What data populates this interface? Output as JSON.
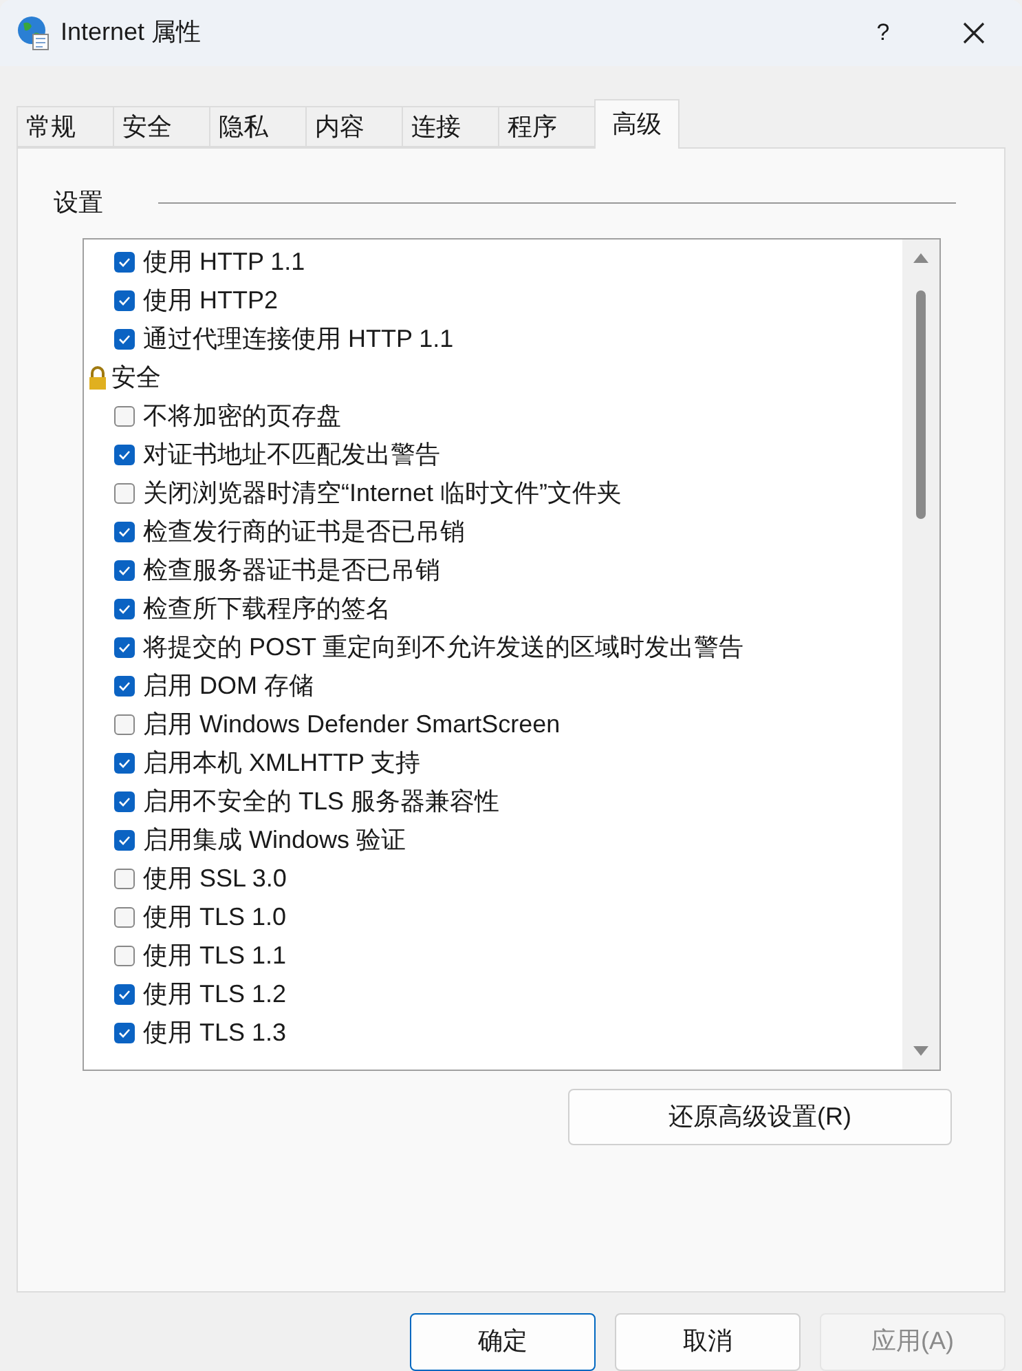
{
  "window": {
    "title": "Internet 属性",
    "help": "?"
  },
  "tabs": [
    {
      "label": "常规",
      "selected": false
    },
    {
      "label": "安全",
      "selected": false
    },
    {
      "label": "隐私",
      "selected": false
    },
    {
      "label": "内容",
      "selected": false
    },
    {
      "label": "连接",
      "selected": false
    },
    {
      "label": "程序",
      "selected": false
    },
    {
      "label": "高级",
      "selected": true
    }
  ],
  "group": {
    "title": "设置"
  },
  "settings": [
    {
      "kind": "checkbox",
      "label": "使用 HTTP 1.1",
      "checked": true
    },
    {
      "kind": "checkbox",
      "label": "使用 HTTP2",
      "checked": true
    },
    {
      "kind": "checkbox",
      "label": "通过代理连接使用 HTTP 1.1",
      "checked": true
    },
    {
      "kind": "category",
      "label": "安全",
      "children": [
        {
          "kind": "checkbox",
          "label": "不将加密的页存盘",
          "checked": false
        },
        {
          "kind": "checkbox",
          "label": "对证书地址不匹配发出警告",
          "checked": true
        },
        {
          "kind": "checkbox",
          "label": "关闭浏览器时清空“Internet 临时文件”文件夹",
          "checked": false
        },
        {
          "kind": "checkbox",
          "label": "检查发行商的证书是否已吊销",
          "checked": true
        },
        {
          "kind": "checkbox",
          "label": "检查服务器证书是否已吊销",
          "checked": true
        },
        {
          "kind": "checkbox",
          "label": "检查所下载程序的签名",
          "checked": true
        },
        {
          "kind": "checkbox",
          "label": "将提交的 POST 重定向到不允许发送的区域时发出警告",
          "checked": true
        },
        {
          "kind": "checkbox",
          "label": "启用 DOM 存储",
          "checked": true
        },
        {
          "kind": "checkbox",
          "label": "启用 Windows Defender SmartScreen",
          "checked": false
        },
        {
          "kind": "checkbox",
          "label": "启用本机 XMLHTTP 支持",
          "checked": true
        },
        {
          "kind": "checkbox",
          "label": "启用不安全的 TLS 服务器兼容性",
          "checked": true
        },
        {
          "kind": "checkbox",
          "label": "启用集成 Windows 验证",
          "checked": true
        },
        {
          "kind": "checkbox",
          "label": "使用 SSL 3.0",
          "checked": false
        },
        {
          "kind": "checkbox",
          "label": "使用 TLS 1.0",
          "checked": false
        },
        {
          "kind": "checkbox",
          "label": "使用 TLS 1.1",
          "checked": false
        },
        {
          "kind": "checkbox",
          "label": "使用 TLS 1.2",
          "checked": true
        },
        {
          "kind": "checkbox",
          "label": "使用 TLS 1.3",
          "checked": true
        }
      ]
    }
  ],
  "reset_button": "还原高级设置(R)",
  "buttons": [
    {
      "label": "确定",
      "kind": "default",
      "disabled": false
    },
    {
      "label": "取消",
      "kind": "normal",
      "disabled": false
    },
    {
      "label": "应用(A)",
      "kind": "normal",
      "disabled": true
    }
  ]
}
